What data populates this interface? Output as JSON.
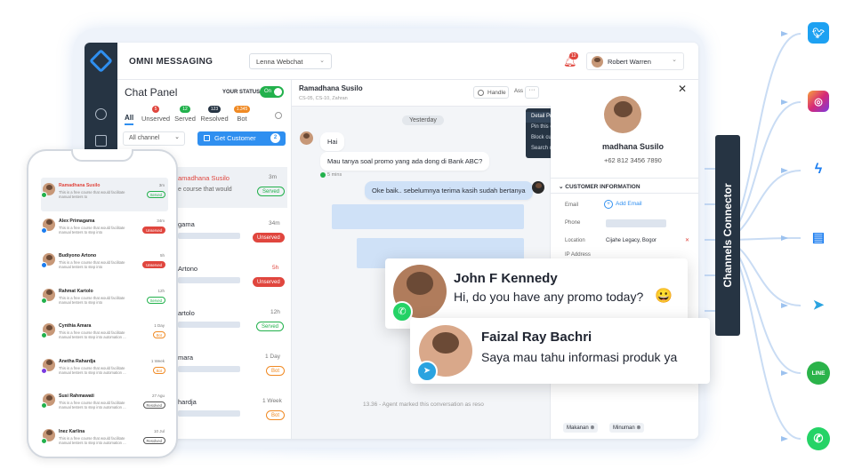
{
  "app": {
    "title": "OMNI MESSAGING",
    "channel_select": "Lenna Webchat",
    "notif_count": "12",
    "user_name": "Robert Warren"
  },
  "chat_panel": {
    "title": "Chat Panel",
    "status_label": "YOUR STATUS",
    "status_toggle": "On",
    "tabs": [
      {
        "label": "All",
        "count": ""
      },
      {
        "label": "Unserved",
        "count": "5"
      },
      {
        "label": "Served",
        "count": "12"
      },
      {
        "label": "Resolved",
        "count": "123"
      },
      {
        "label": "Bot",
        "count": "1.345"
      }
    ],
    "filter": "All channel",
    "get_customer": "Get Customer",
    "get_customer_count": "2",
    "items": [
      {
        "name": "amadhana Susilo",
        "preview": "e course that would",
        "time": "3m",
        "status": "Served"
      },
      {
        "name": "gama",
        "preview": "",
        "time": "34m",
        "status": "Unserved"
      },
      {
        "name": "Artono",
        "preview": "",
        "time": "5h",
        "status": "Unserved"
      },
      {
        "name": "artolo",
        "preview": "",
        "time": "12h",
        "status": "Served"
      },
      {
        "name": "mara",
        "preview": "",
        "time": "1 Day",
        "status": "Bot"
      },
      {
        "name": "hardja",
        "preview": "",
        "time": "1 Week",
        "status": "Bot"
      }
    ]
  },
  "conversation": {
    "name": "Ramadhana Susilo",
    "sub": "CS-05, CS-10, Zahran",
    "handle": "Handle",
    "assign": "Ass",
    "date": "Yesterday",
    "msg1": "Hai",
    "msg2": "Mau tanya soal promo yang ada dong di Bank ABC?",
    "msg2_time": "5 mins",
    "msg3": "Oke baik.. sebelumnya terima kasih sudah bertanya",
    "footer": "13.36 - Agent marked this conversation as reso"
  },
  "context_menu": [
    "Detail Profile",
    "Pin this customer",
    "Block customer",
    "Search chat"
  ],
  "profile": {
    "name": "madhana Susilo",
    "phone": "+62 812 3456 7890",
    "section": "CUSTOMER INFORMATION",
    "email_label": "Email",
    "add_email": "Add Email",
    "phone_label": "Phone",
    "location_label": "Location",
    "location_value": "Cijahe Legacy, Bogor",
    "ip_label": "IP Address",
    "tags": [
      "Makanan",
      "Minuman"
    ]
  },
  "overlay1": {
    "name": "John F Kennedy",
    "message": "Hi, do you have any promo today?",
    "emoji": "😀"
  },
  "overlay2": {
    "name": "Faizal Ray Bachri",
    "message": "Saya mau tahu informasi produk ya"
  },
  "connector": {
    "label": "Channels Connector",
    "line_badge": "LINE"
  },
  "mobile": {
    "items": [
      {
        "name": "Ramadhana Susilo",
        "preview": "This is a free course that would facilitate manual testers to",
        "time": "3m",
        "status": "Served"
      },
      {
        "name": "Alex Primagama",
        "preview": "This is a free course that would facilitate manual testers to step into",
        "time": "34m",
        "status": "Unserved"
      },
      {
        "name": "Budiyono Artono",
        "preview": "This is a free course that would facilitate manual testers to step into",
        "time": "5h",
        "status": "Unserved"
      },
      {
        "name": "Rahmat Kartolo",
        "preview": "This is a free course that would facilitate manual testers to step into",
        "time": "12h",
        "status": "Served"
      },
      {
        "name": "Cynthia Amara",
        "preview": "This is a free course that would facilitate manual testers to step into automation ...",
        "time": "1 Day",
        "status": "Bot"
      },
      {
        "name": "Anetha Rahardja",
        "preview": "This is a free course that would facilitate manual testers to step into automation ...",
        "time": "1 Week",
        "status": "Bot"
      },
      {
        "name": "Susi Rahmawati",
        "preview": "This is a free course that would facilitate manual testers to step into automation ...",
        "time": "27 Agu",
        "status": "Resolved"
      },
      {
        "name": "Inez Karlina",
        "preview": "This is a free course that would facilitate manual testers to step into automation ...",
        "time": "10 Jul",
        "status": "Resolved"
      }
    ]
  },
  "colors": {
    "primary": "#2f8ff0",
    "dark": "#263443",
    "green": "#22b14c",
    "red": "#e0463e",
    "orange": "#f08a24"
  }
}
